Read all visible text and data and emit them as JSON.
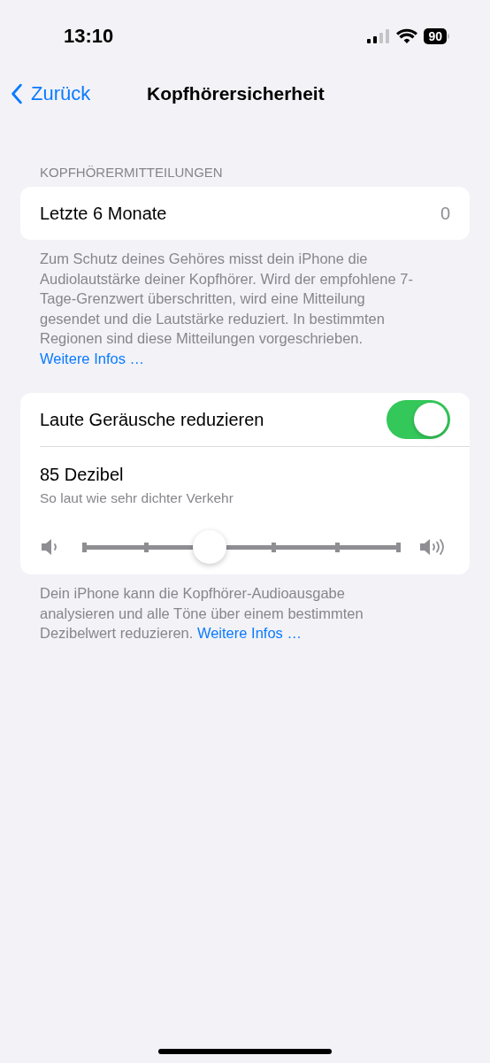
{
  "status_bar": {
    "time": "13:10",
    "battery": "90"
  },
  "nav": {
    "back": "Zurück",
    "title": "Kopfhörersicherheit"
  },
  "sections": [
    {
      "header": "KOPFHÖRERMITTEILUNGEN",
      "rows": [
        {
          "kind": "value",
          "label": "Letzte 6 Monate",
          "value": "0"
        }
      ],
      "footer": {
        "text": "Zum Schutz deines Gehöres misst dein iPhone die Audiolautstärke deiner Kopfhörer. Wird der empfohlene 7-Tage-Grenzwert überschritten, wird eine Mitteilung gesendet und die Lautstärke reduziert. In bestimmten Regionen sind diese Mitteilungen vorgeschrieben. ",
        "link": "Weitere Infos …"
      }
    },
    {
      "rows": [
        {
          "kind": "toggle",
          "label": "Laute Geräusche reduzieren",
          "on": true
        },
        {
          "kind": "info",
          "label": "85 Dezibel",
          "subtitle": "So laut wie sehr dichter Verkehr"
        },
        {
          "kind": "slider",
          "level": 0.4
        }
      ],
      "footer": {
        "text": "Dein iPhone kann die Kopfhörer-Audioausgabe analysieren und alle Töne über einem bestimmten Dezibelwert reduzieren. ",
        "link": "Weitere Infos …"
      }
    }
  ]
}
